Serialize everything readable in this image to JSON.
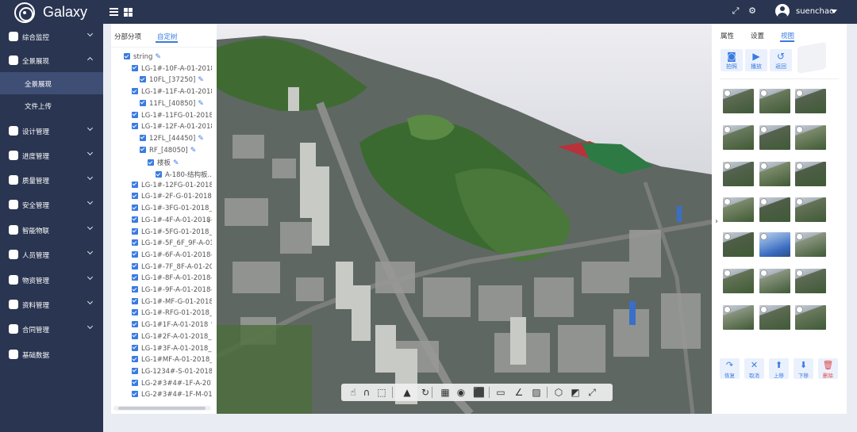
{
  "app": {
    "brand": "Galaxy",
    "user": "suenchao"
  },
  "header_icons": [
    "menu-icon",
    "grid-icon",
    "fullscreen-icon",
    "settings-icon",
    "user-avatar-icon"
  ],
  "nav": {
    "items": [
      {
        "label": "综合监控",
        "icon": "monitor-icon"
      },
      {
        "label": "全景展现",
        "icon": "globe-icon",
        "open": true
      },
      {
        "label": "设计管理",
        "icon": "tools-icon"
      },
      {
        "label": "进度管理",
        "icon": "progress-icon"
      },
      {
        "label": "质量管理",
        "icon": "shield-check-icon"
      },
      {
        "label": "安全管理",
        "icon": "shield-icon"
      },
      {
        "label": "智能物联",
        "icon": "network-icon"
      },
      {
        "label": "人员管理",
        "icon": "person-icon"
      },
      {
        "label": "物资管理",
        "icon": "box-icon"
      },
      {
        "label": "资料管理",
        "icon": "folder-icon"
      },
      {
        "label": "合同管理",
        "icon": "contract-icon"
      },
      {
        "label": "基础数据",
        "icon": "chart-icon"
      }
    ],
    "sub": [
      {
        "label": "全景展现",
        "active": true
      },
      {
        "label": "文件上传",
        "active": false
      }
    ]
  },
  "tree": {
    "tabs": [
      "分部分项",
      "自定树"
    ],
    "active_tab": 1,
    "nodes": [
      {
        "label": "string",
        "level": 0,
        "pen": true
      },
      {
        "label": "LG-1#-10F-A-01-2018",
        "level": 1,
        "pen": false
      },
      {
        "label": "10FL_[37250]",
        "level": 2,
        "pen": true
      },
      {
        "label": "LG-1#-11F-A-01-2018",
        "level": 1,
        "pen": false
      },
      {
        "label": "11FL_[40850]",
        "level": 2,
        "pen": true
      },
      {
        "label": "LG-1#-11FG-01-2018_",
        "level": 1,
        "pen": false
      },
      {
        "label": "LG-1#-12F-A-01-2018",
        "level": 1,
        "pen": false
      },
      {
        "label": "12FL_[44450]",
        "level": 2,
        "pen": true
      },
      {
        "label": "RF_[48050]",
        "level": 2,
        "pen": true
      },
      {
        "label": "楼板",
        "level": 3,
        "pen": true
      },
      {
        "label": "A-180-结构板...",
        "level": 4,
        "pen": false
      },
      {
        "label": "LG-1#-12FG-01-2018_",
        "level": 1,
        "pen": false
      },
      {
        "label": "LG-1#-2F-G-01-20180",
        "level": 1,
        "pen": false
      },
      {
        "label": "LG-1#-3FG-01-2018_F",
        "level": 1,
        "pen": false
      },
      {
        "label": "LG-1#-4F-A-01-2018-",
        "level": 1,
        "pen": false
      },
      {
        "label": "LG-1#-5FG-01-2018_F",
        "level": 1,
        "pen": false
      },
      {
        "label": "LG-1#-5F_6F_9F-A-01",
        "level": 1,
        "pen": false
      },
      {
        "label": "LG-1#-6F-A-01-2018-",
        "level": 1,
        "pen": false
      },
      {
        "label": "LG-1#-7F_8F-A-01-20",
        "level": 1,
        "pen": false
      },
      {
        "label": "LG-1#-8F-A-01-2018-",
        "level": 1,
        "pen": false
      },
      {
        "label": "LG-1#-9F-A-01-2018-",
        "level": 1,
        "pen": false
      },
      {
        "label": "LG-1#-MF-G-01-2018_",
        "level": 1,
        "pen": false
      },
      {
        "label": "LG-1#-RFG-01-2018_F",
        "level": 1,
        "pen": false
      },
      {
        "label": "LG-1#1F-A-01-2018",
        "level": 1,
        "pen": true
      },
      {
        "label": "LG-1#2F-A-01-2018_",
        "level": 1,
        "pen": false
      },
      {
        "label": "LG-1#3F-A-01-2018_F",
        "level": 1,
        "pen": false
      },
      {
        "label": "LG-1#MF-A-01-2018_",
        "level": 1,
        "pen": false
      },
      {
        "label": "LG-1234#-S-01-2018-",
        "level": 1,
        "pen": false
      },
      {
        "label": "LG-2#3#4#-1F-A-2018",
        "level": 1,
        "pen": false
      },
      {
        "label": "LG-2#3#4#-1F-M-01-2",
        "level": 1,
        "pen": false
      }
    ]
  },
  "toolbar3d": {
    "icons": [
      "pointer-icon",
      "magnet-icon",
      "cube-select-icon",
      "terrain-icon",
      "rotate-icon",
      "shadow-icon",
      "light-icon",
      "box-icon",
      "measure-line-icon",
      "angle-icon",
      "area-icon",
      "cube-icon",
      "section-icon",
      "fullscreen-icon"
    ]
  },
  "rpanel": {
    "tabs": [
      "属性",
      "设置",
      "视图"
    ],
    "active_tab": 2,
    "actions": [
      {
        "label": "拍照",
        "icon": "camera-icon"
      },
      {
        "label": "播放",
        "icon": "play-icon"
      },
      {
        "label": "返回",
        "icon": "undo-icon"
      }
    ],
    "bottom_actions": [
      {
        "label": "恢复",
        "icon": "redo-icon",
        "danger": false
      },
      {
        "label": "取消",
        "icon": "close-icon",
        "danger": false
      },
      {
        "label": "上移",
        "icon": "move-up-icon",
        "danger": false
      },
      {
        "label": "下移",
        "icon": "move-down-icon",
        "danger": false
      },
      {
        "label": "删除",
        "icon": "trash-icon",
        "danger": true
      }
    ]
  },
  "colors": {
    "header_bg": "#2a3551",
    "accent": "#3a7be0",
    "danger": "#e04848",
    "nav_active": "#3e4e74"
  }
}
